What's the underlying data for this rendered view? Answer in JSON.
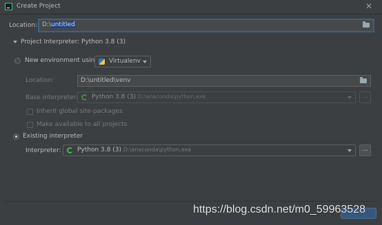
{
  "window": {
    "title": "Create Project",
    "close_glyph": "✕"
  },
  "location": {
    "label": "Location:",
    "value_prefix": "D:\\",
    "value_selected": "untitled"
  },
  "interpreter_section": {
    "title": "Project Interpreter: Python 3.8 (3)"
  },
  "new_env": {
    "label": "New environment using",
    "tool": "Virtualenv",
    "location_label": "Location:",
    "location_value": "D:\\untitled\\venv",
    "base_label": "Base interpreter:",
    "base_name": "Python 3.8 (3)",
    "base_path": "D:\\anaconda\\python.exe",
    "inherit_label": "Inherit global site-packages",
    "available_label": "Make available to all projects"
  },
  "existing": {
    "label": "Existing interpreter",
    "interpreter_label": "Interpreter:",
    "interpreter_name": "Python 3.8 (3)",
    "interpreter_path": "D:\\anaconda\\python.exe"
  },
  "buttons": {
    "ellipsis": "..."
  },
  "watermark": "https://blog.csdn.net/m0_59963528",
  "colors": {
    "background": "#3c3f41",
    "text": "#bbbbbb",
    "selection": "#214283",
    "focus_border": "#3d6185",
    "ok_green": "#4fb34f"
  }
}
